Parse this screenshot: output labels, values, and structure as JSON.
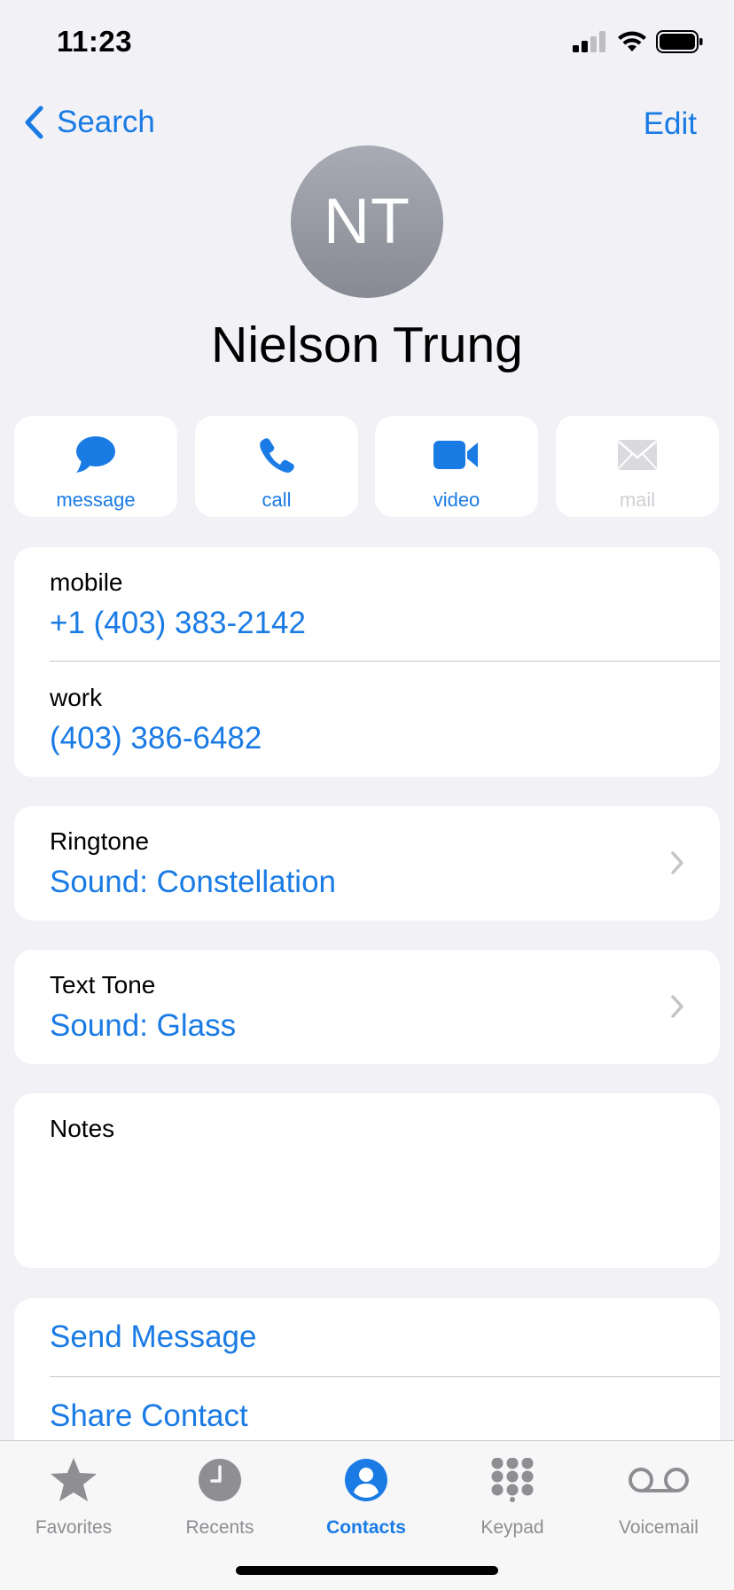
{
  "status_bar": {
    "time": "11:23"
  },
  "nav": {
    "back_label": "Search",
    "edit_label": "Edit"
  },
  "contact": {
    "initials": "NT",
    "name": "Nielson Trung"
  },
  "actions": [
    {
      "label": "message",
      "icon": "message-icon",
      "enabled": true
    },
    {
      "label": "call",
      "icon": "phone-icon",
      "enabled": true
    },
    {
      "label": "video",
      "icon": "video-icon",
      "enabled": true
    },
    {
      "label": "mail",
      "icon": "mail-icon",
      "enabled": false
    }
  ],
  "phones": [
    {
      "label": "mobile",
      "value": "+1 (403) 383-2142"
    },
    {
      "label": "work",
      "value": "(403) 386-6482"
    }
  ],
  "ringtone": {
    "label": "Ringtone",
    "value": "Sound: Constellation"
  },
  "text_tone": {
    "label": "Text Tone",
    "value": "Sound: Glass"
  },
  "notes": {
    "label": "Notes"
  },
  "links": {
    "send_message": "Send Message",
    "share_contact": "Share Contact"
  },
  "tabs": [
    {
      "label": "Favorites",
      "icon": "star-icon",
      "active": false
    },
    {
      "label": "Recents",
      "icon": "clock-icon",
      "active": false
    },
    {
      "label": "Contacts",
      "icon": "person-icon",
      "active": true
    },
    {
      "label": "Keypad",
      "icon": "keypad-icon",
      "active": false
    },
    {
      "label": "Voicemail",
      "icon": "voicemail-icon",
      "active": false
    }
  ],
  "colors": {
    "accent": "#1A7BE5",
    "background": "#F1F1F6",
    "inactive_tab": "#8E8E93"
  }
}
